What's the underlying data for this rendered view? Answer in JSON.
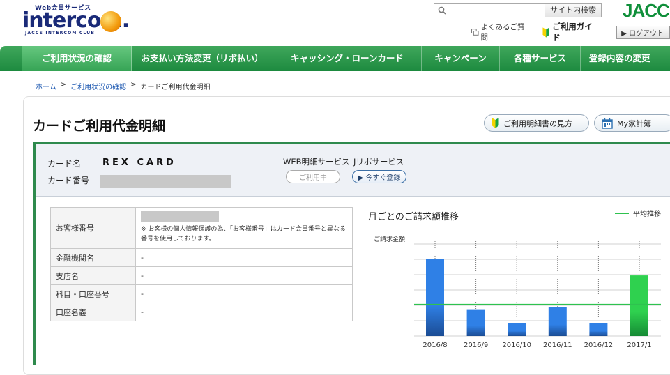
{
  "header": {
    "logo_small": "Web会員サービス",
    "logo_main": "intercom.",
    "logo_sub": "JACCS INTERCOM CLUB",
    "search_button": "サイト内検索",
    "search_placeholder": "",
    "brand": "JACC",
    "faq": "よくあるご質問",
    "guide": "ご利用ガイド",
    "logout": "▶ ログアウト"
  },
  "nav": [
    {
      "label": "ご利用状況の確認",
      "active": true
    },
    {
      "label": "お支払い方法変更（リボ払い）",
      "active": false
    },
    {
      "label": "キャッシング・ローンカード",
      "active": false
    },
    {
      "label": "キャンペーン",
      "active": false
    },
    {
      "label": "各種サービス",
      "active": false
    },
    {
      "label": "登録内容の変更",
      "active": false
    }
  ],
  "breadcrumb": {
    "home": "ホーム",
    "sep": ">",
    "usage": "ご利用状況の確認",
    "current": "カードご利用代金明細"
  },
  "page": {
    "title": "カードご利用代金明細",
    "howto_button": "ご利用明細書の見方",
    "kakeibo_button": "My家計簿"
  },
  "card": {
    "name_label": "カード名",
    "name_value": "REX CARD",
    "number_label": "カード番号",
    "web_service_label": "WEB明細サービス",
    "web_service_status": "ご利用中",
    "ribo_label": "Jリボサービス",
    "ribo_button": "▶ 今すぐ登録"
  },
  "bank": {
    "rows": [
      {
        "key": "お客様番号",
        "value": "",
        "note": "※ お客様の個人情報保護の為、「お客様番号」はカード会員番号と異なる番号を使用しております。"
      },
      {
        "key": "金融機関名",
        "value": "-"
      },
      {
        "key": "支店名",
        "value": "-"
      },
      {
        "key": "科目・口座番号",
        "value": "-"
      },
      {
        "key": "口座名義",
        "value": "-"
      }
    ]
  },
  "chart_data": {
    "type": "bar",
    "title": "月ごとのご請求額推移",
    "ylabel": "ご請求金額",
    "categories": [
      "2016/8",
      "2016/9",
      "2016/10",
      "2016/11",
      "2016/12",
      "2017/1"
    ],
    "series": [
      {
        "values": [
          100,
          34,
          17,
          38,
          17,
          79
        ]
      }
    ],
    "average": {
      "name": "平均推移",
      "value": 41
    },
    "ylim": [
      0,
      120
    ],
    "colors": {
      "bar": "#2f80e6",
      "latest_bar": "#2fd14f",
      "average": "#2fc24f"
    },
    "grid": true
  }
}
